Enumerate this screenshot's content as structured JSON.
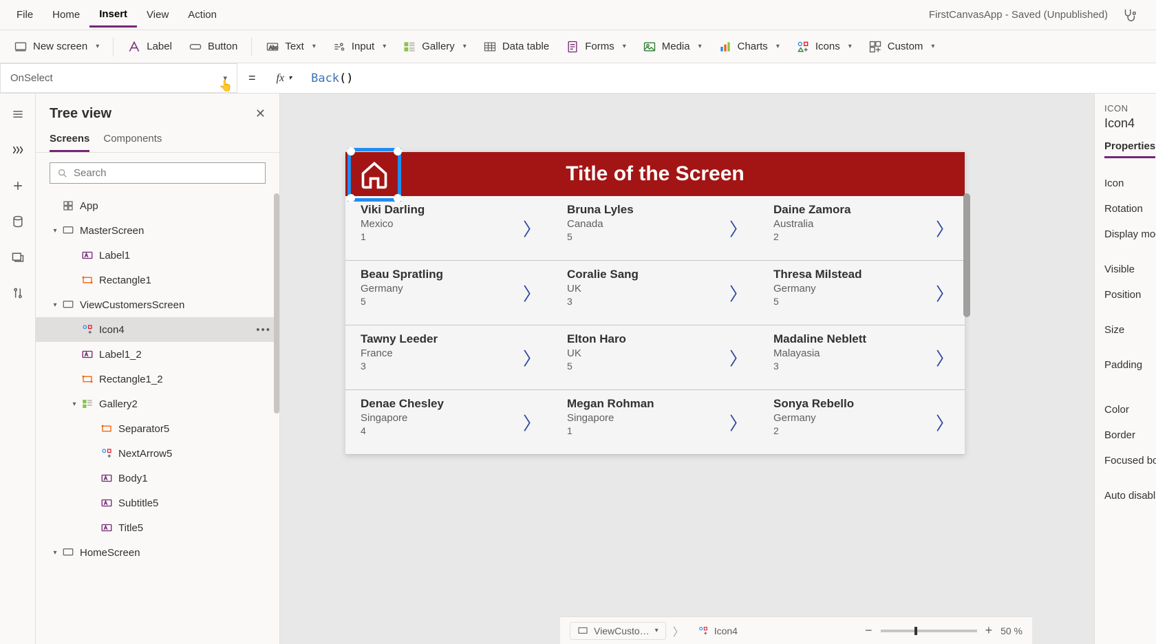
{
  "menubar": {
    "items": [
      "File",
      "Home",
      "Insert",
      "View",
      "Action"
    ],
    "active_index": 2,
    "app_title": "FirstCanvasApp - Saved (Unpublished)"
  },
  "ribbon": {
    "new_screen": "New screen",
    "label": "Label",
    "button": "Button",
    "text": "Text",
    "input": "Input",
    "gallery": "Gallery",
    "data_table": "Data table",
    "forms": "Forms",
    "media": "Media",
    "charts": "Charts",
    "icons": "Icons",
    "custom": "Custom"
  },
  "formula": {
    "property": "OnSelect",
    "fn": "Back",
    "args": "()"
  },
  "treeview": {
    "title": "Tree view",
    "tabs": [
      "Screens",
      "Components"
    ],
    "active_tab": 0,
    "search_placeholder": "Search",
    "nodes": [
      {
        "label": "App",
        "depth": 0,
        "icon": "app",
        "caret": ""
      },
      {
        "label": "MasterScreen",
        "depth": 0,
        "icon": "screen",
        "caret": "▾"
      },
      {
        "label": "Label1",
        "depth": 1,
        "icon": "label",
        "caret": ""
      },
      {
        "label": "Rectangle1",
        "depth": 1,
        "icon": "rect",
        "caret": ""
      },
      {
        "label": "ViewCustomersScreen",
        "depth": 0,
        "icon": "screen",
        "caret": "▾"
      },
      {
        "label": "Icon4",
        "depth": 1,
        "icon": "iconctrl",
        "caret": "",
        "selected": true,
        "more": true
      },
      {
        "label": "Label1_2",
        "depth": 1,
        "icon": "label",
        "caret": ""
      },
      {
        "label": "Rectangle1_2",
        "depth": 1,
        "icon": "rect",
        "caret": ""
      },
      {
        "label": "Gallery2",
        "depth": 1,
        "icon": "gallery",
        "caret": "▾"
      },
      {
        "label": "Separator5",
        "depth": 2,
        "icon": "sep",
        "caret": ""
      },
      {
        "label": "NextArrow5",
        "depth": 2,
        "icon": "iconctrl",
        "caret": ""
      },
      {
        "label": "Body1",
        "depth": 2,
        "icon": "label",
        "caret": ""
      },
      {
        "label": "Subtitle5",
        "depth": 2,
        "icon": "label",
        "caret": ""
      },
      {
        "label": "Title5",
        "depth": 2,
        "icon": "label",
        "caret": ""
      },
      {
        "label": "HomeScreen",
        "depth": 0,
        "icon": "screen",
        "caret": "▾"
      }
    ]
  },
  "canvas": {
    "screen_title": "Title of the Screen",
    "rows": [
      [
        {
          "name": "Viki  Darling",
          "country": "Mexico",
          "num": "1"
        },
        {
          "name": "Bruna  Lyles",
          "country": "Canada",
          "num": "5"
        },
        {
          "name": "Daine  Zamora",
          "country": "Australia",
          "num": "2"
        }
      ],
      [
        {
          "name": "Beau  Spratling",
          "country": "Germany",
          "num": "5"
        },
        {
          "name": "Coralie  Sang",
          "country": "UK",
          "num": "3"
        },
        {
          "name": "Thresa  Milstead",
          "country": "Germany",
          "num": "5"
        }
      ],
      [
        {
          "name": "Tawny  Leeder",
          "country": "France",
          "num": "3"
        },
        {
          "name": "Elton  Haro",
          "country": "UK",
          "num": "5"
        },
        {
          "name": "Madaline  Neblett",
          "country": "Malayasia",
          "num": "3"
        }
      ],
      [
        {
          "name": "Denae  Chesley",
          "country": "Singapore",
          "num": "4"
        },
        {
          "name": "Megan  Rohman",
          "country": "Singapore",
          "num": "1"
        },
        {
          "name": "Sonya  Rebello",
          "country": "Germany",
          "num": "2"
        }
      ]
    ]
  },
  "props": {
    "type": "ICON",
    "name": "Icon4",
    "tab": "Properties",
    "rows": [
      "Icon",
      "Rotation",
      "Display mode"
    ],
    "rows2": [
      "Visible",
      "Position"
    ],
    "rows3": [
      "Size"
    ],
    "rows4": [
      "Padding"
    ],
    "rows5": [
      "Color",
      "Border",
      "Focused border"
    ],
    "rows6": [
      "Auto disable"
    ]
  },
  "status": {
    "screen": "ViewCusto…",
    "element": "Icon4",
    "zoom": "50  %"
  }
}
